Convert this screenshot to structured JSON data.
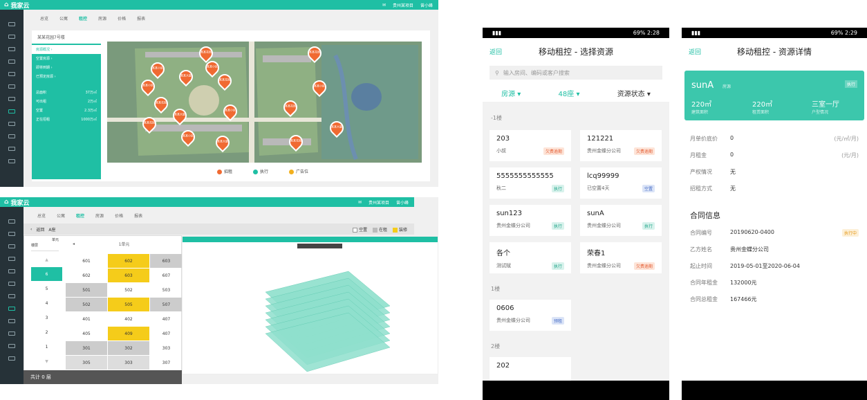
{
  "app": {
    "logo": "我家云",
    "region": "贵州某项目",
    "user": "曾小峰"
  },
  "desk1": {
    "tabs": [
      "总览",
      "公寓",
      "租控",
      "房源",
      "价格",
      "报表"
    ],
    "active_tab": 2,
    "left_title": "某某花园7号楼",
    "left_items": [
      "房源概况 ›",
      "空置房源 ›",
      "即将到期 ›",
      "已预定房源 ›"
    ],
    "stats": [
      {
        "k": "总面积",
        "v": "37万㎡"
      },
      {
        "k": "可出租",
        "v": "2万㎡"
      },
      {
        "k": "空置",
        "v": "2.3万㎡"
      },
      {
        "k": "正在招租",
        "v": "1000万㎡"
      }
    ],
    "pins": [
      "某某花园",
      "某某小区",
      "某某大厦",
      "某某小区",
      "某某花园",
      "某某小区",
      "某某花园",
      "某某大厦",
      "某某小区",
      "某某花园",
      "某某小区",
      "某某大厦",
      "某某花园",
      "某某小区",
      "某某花园",
      "某某大厦"
    ],
    "legend": [
      "招租",
      "执行",
      "广告位"
    ]
  },
  "desk2": {
    "tabs": [
      "总览",
      "公寓",
      "租控",
      "房源",
      "价格",
      "报表"
    ],
    "active_tab": 2,
    "back": "返回",
    "building": "A座",
    "floor_header_a": "单元",
    "floor_header_b": "楼层",
    "unit_label": "1单元",
    "floors": [
      "",
      "6",
      "5",
      "4",
      "3",
      "2",
      "1",
      ""
    ],
    "legend": [
      "空置",
      "在租",
      "装修"
    ],
    "rows": [
      [
        "601",
        "602",
        "603"
      ],
      [
        "602",
        "603",
        "607"
      ],
      [
        "501",
        "502",
        "503"
      ],
      [
        "502",
        "505",
        "507"
      ],
      [
        "401",
        "402",
        "407"
      ],
      [
        "405",
        "409",
        "407"
      ],
      [
        "301",
        "302",
        "303"
      ],
      [
        "305",
        "303",
        "307"
      ]
    ],
    "footer": "共计 0 层"
  },
  "phone1": {
    "time": "2:28",
    "battery": "69%",
    "back": "返回",
    "title": "移动租控 - 选择资源",
    "search_placeholder": "输入房间、编码或客户搜索",
    "filters": [
      "房源",
      "48座",
      "资源状态"
    ],
    "sections": [
      "-1楼",
      "1楼",
      "2楼"
    ],
    "cards": [
      {
        "name": "203",
        "sub": "小叔",
        "tag": "欠费逾期",
        "t": "o"
      },
      {
        "name": "121221",
        "sub": "贵州金蝶分公司",
        "tag": "欠费逾期",
        "t": "o"
      },
      {
        "name": "5555555555555",
        "sub": "秋二",
        "tag": "执行",
        "t": "g"
      },
      {
        "name": "lcq99999",
        "sub": "已空置4天",
        "tag": "空置",
        "t": "b"
      },
      {
        "name": "sun123",
        "sub": "贵州金蝶分公司",
        "tag": "执行",
        "t": "g"
      },
      {
        "name": "sunA",
        "sub": "贵州金蝶分公司",
        "tag": "执行",
        "t": "g"
      },
      {
        "name": "各个",
        "sub": "测试赋",
        "tag": "执行",
        "t": "g"
      },
      {
        "name": "荣春1",
        "sub": "贵州金蝶分公司",
        "tag": "欠费逾期",
        "t": "o"
      },
      {
        "name": "0606",
        "sub": "贵州金蝶分公司",
        "tag": "预租",
        "t": "b"
      },
      {
        "name": "202",
        "sub": "",
        "tag": "",
        "t": "b"
      }
    ]
  },
  "phone2": {
    "time": "2:29",
    "battery": "69%",
    "back": "返回",
    "title": "移动租控 - 资源详情",
    "card_name": "sunA",
    "card_sub": "房源",
    "card_tag": "执行",
    "card_stats": [
      {
        "v": "220㎡",
        "k": "建筑面积"
      },
      {
        "v": "220㎡",
        "k": "租赁面积"
      },
      {
        "v": "三室一厅",
        "k": "户型情况"
      }
    ],
    "fields": [
      {
        "k": "月单价底价",
        "v": "0",
        "u": "(元/㎡/月)"
      },
      {
        "k": "月租金",
        "v": "0",
        "u": "(元/月)"
      },
      {
        "k": "产权情况",
        "v": "无",
        "u": ""
      },
      {
        "k": "招租方式",
        "v": "无",
        "u": ""
      }
    ],
    "contract_title": "合同信息",
    "contract": [
      {
        "k": "合同编号",
        "v": "20190620-0400",
        "tag": "执行中"
      },
      {
        "k": "乙方姓名",
        "v": "贵州金蝶分公司",
        "tag": ""
      },
      {
        "k": "起止时间",
        "v": "2019-05-01至2020-06-04",
        "tag": ""
      },
      {
        "k": "合同年租金",
        "v": "132000元",
        "tag": ""
      },
      {
        "k": "合同总租金",
        "v": "167466元",
        "tag": ""
      }
    ]
  }
}
